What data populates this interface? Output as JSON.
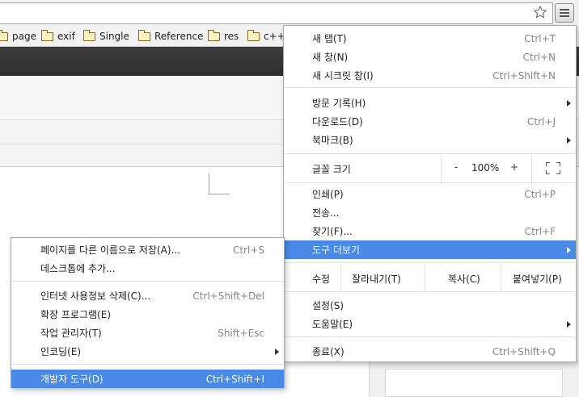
{
  "toolbar": {
    "star_icon": "star-outline-icon",
    "menu_icon": "hamburger-menu-icon"
  },
  "bookmarks": [
    {
      "label": "page"
    },
    {
      "label": "exif"
    },
    {
      "label": "Single"
    },
    {
      "label": "Reference"
    },
    {
      "label": "res"
    },
    {
      "label": "c++"
    }
  ],
  "main_menu": {
    "new_tab": {
      "label": "새 탭(T)",
      "shortcut": "Ctrl+T"
    },
    "new_window": {
      "label": "새 창(N)",
      "shortcut": "Ctrl+N"
    },
    "new_incognito": {
      "label": "새 시크릿 창(I)",
      "shortcut": "Ctrl+Shift+N"
    },
    "history": {
      "label": "방문 기록(H)"
    },
    "downloads": {
      "label": "다운로드(D)",
      "shortcut": "Ctrl+J"
    },
    "bookmarks": {
      "label": "북마크(B)"
    },
    "zoom": {
      "label": "글꼴 크기",
      "minus": "-",
      "value": "100%",
      "plus": "+"
    },
    "print": {
      "label": "인쇄(P)",
      "shortcut": "Ctrl+P"
    },
    "cast": {
      "label": "전송..."
    },
    "find": {
      "label": "찾기(F)...",
      "shortcut": "Ctrl+F"
    },
    "more_tools": {
      "label": "도구 더보기"
    },
    "edit": {
      "label": "수정",
      "cut": "잘라내기(T)",
      "copy": "복사(C)",
      "paste": "붙여넣기(P)"
    },
    "settings": {
      "label": "설정(S)"
    },
    "help": {
      "label": "도움말(E)"
    },
    "exit": {
      "label": "종료(X)",
      "shortcut": "Ctrl+Shift+Q"
    }
  },
  "sub_menu": {
    "save_page_as": {
      "label": "페이지를 다른 이름으로 저장(A)...",
      "shortcut": "Ctrl+S"
    },
    "add_to_desktop": {
      "label": "데스크톱에 추가..."
    },
    "clear_browsing_data": {
      "label": "인터넷 사용정보 삭제(C)...",
      "shortcut": "Ctrl+Shift+Del"
    },
    "extensions": {
      "label": "확장 프로그램(E)"
    },
    "task_manager": {
      "label": "작업 관리자(T)",
      "shortcut": "Shift+Esc"
    },
    "encoding": {
      "label": "인코딩(E)"
    },
    "developer_tools": {
      "label": "개발자 도구(D)",
      "shortcut": "Ctrl+Shift+I"
    }
  },
  "colors": {
    "highlight": "#4a89e6",
    "shortcut_text": "#888888",
    "dark_bar": "#333333"
  }
}
